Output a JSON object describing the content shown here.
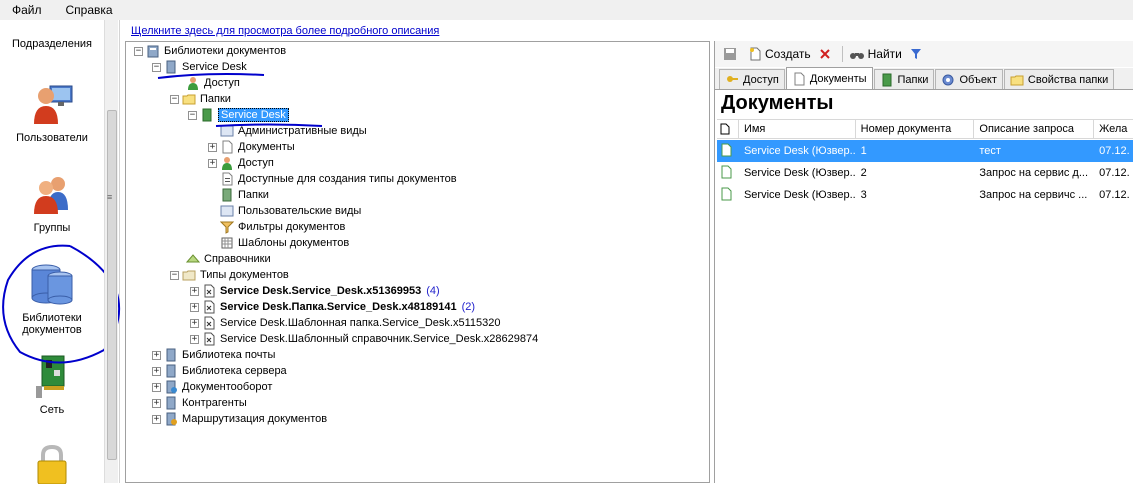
{
  "menu": {
    "file": "Файл",
    "help": "Справка"
  },
  "nav": {
    "items": [
      {
        "label": "Подразделения"
      },
      {
        "label": "Пользователи"
      },
      {
        "label": "Группы"
      },
      {
        "label": "Библиотеки документов"
      },
      {
        "label": "Сеть"
      }
    ]
  },
  "description_link": "Щелкните здесь для просмотра более подробного описания",
  "tree": {
    "root": "Библиотеки документов",
    "service_desk": "Service Desk",
    "access": "Доступ",
    "folders": "Папки",
    "sd_folder": "Service Desk",
    "admin_views": "Административные виды",
    "documents": "Документы",
    "access2": "Доступ",
    "available_types": "Доступные для создания типы документов",
    "folders2": "Папки",
    "user_views": "Пользовательские виды",
    "doc_filters": "Фильтры документов",
    "doc_templates": "Шаблоны документов",
    "references": "Справочники",
    "doc_types": "Типы документов",
    "type1": "Service Desk.Service_Desk.x51369953",
    "type1_count": "(4)",
    "type2": "Service Desk.Папка.Service_Desk.x48189141",
    "type2_count": "(2)",
    "type3": "Service Desk.Шаблонная папка.Service_Desk.x5115320",
    "type4": "Service Desk.Шаблонный справочник.Service_Desk.x28629874",
    "mail_lib": "Библиотека почты",
    "server_lib": "Библиотека сервера",
    "doc_flow": "Документооборот",
    "contractors": "Контрагенты",
    "routing": "Маршрутизация документов"
  },
  "toolbar": {
    "create": "Создать",
    "find": "Найти"
  },
  "tabs": [
    "Доступ",
    "Документы",
    "Папки",
    "Объект",
    "Свойства папки"
  ],
  "section_title": "Документы",
  "grid": {
    "headers": [
      "Имя",
      "Номер документа",
      "Описание запроса",
      "Жела"
    ],
    "rows": [
      {
        "name": "Service Desk (Юзвер...",
        "number": "1",
        "desc": "тест",
        "date": "07.12."
      },
      {
        "name": "Service Desk (Юзвер...",
        "number": "2",
        "desc": "Запрос на сервис д...",
        "date": "07.12."
      },
      {
        "name": "Service Desk (Юзвер...",
        "number": "3",
        "desc": "Запрос на сервичс ...",
        "date": "07.12."
      }
    ]
  },
  "colors": {
    "selection": "#3399ff",
    "link": "#0000cc",
    "annotation": "#0000cc"
  }
}
